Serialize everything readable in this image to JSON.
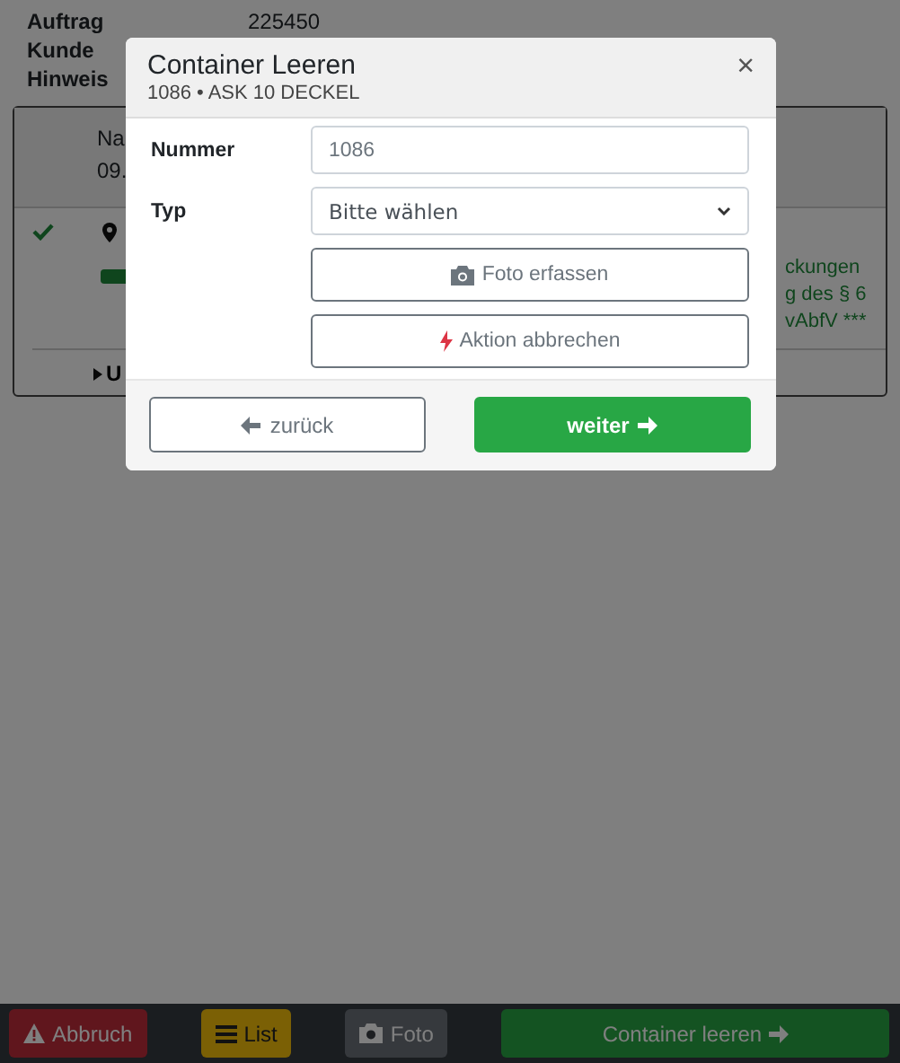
{
  "order_info": [
    {
      "label": "Auftrag",
      "value": "225450"
    },
    {
      "label": "Kunde"
    },
    {
      "label": "Hinweis"
    }
  ],
  "card": {
    "top_lines": [
      "Na",
      "09."
    ],
    "done": true,
    "right_lines": [
      "ckungen",
      "g des § 6",
      "vAbfV ***"
    ],
    "toggle": "U"
  },
  "modal": {
    "title": "Container Leeren",
    "subtitle": "1086 • ASK 10 DECKEL",
    "close": "×",
    "fields": [
      {
        "kind": "input",
        "label": "Nummer",
        "placeholder": "1086"
      },
      {
        "kind": "select",
        "label": "Typ",
        "value": "Bitte wählen"
      }
    ],
    "actions": [
      {
        "kind": "photo",
        "label": "Foto erfassen"
      },
      {
        "kind": "cancel",
        "label": "Aktion abbrechen"
      }
    ],
    "back": "zurück",
    "next": "weiter"
  },
  "bottom_bar": [
    {
      "kind": "abort",
      "label": "Abbruch"
    },
    {
      "kind": "list",
      "label": "List"
    },
    {
      "kind": "photo",
      "label": "Foto"
    },
    {
      "kind": "next",
      "label": "Container leeren"
    }
  ]
}
